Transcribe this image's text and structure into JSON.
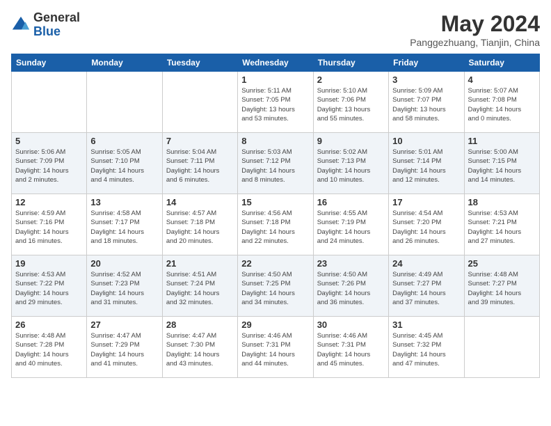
{
  "header": {
    "logo_general": "General",
    "logo_blue": "Blue",
    "month_year": "May 2024",
    "location": "Panggezhuang, Tianjin, China"
  },
  "days_of_week": [
    "Sunday",
    "Monday",
    "Tuesday",
    "Wednesday",
    "Thursday",
    "Friday",
    "Saturday"
  ],
  "weeks": [
    [
      {
        "day": "",
        "info": ""
      },
      {
        "day": "",
        "info": ""
      },
      {
        "day": "",
        "info": ""
      },
      {
        "day": "1",
        "info": "Sunrise: 5:11 AM\nSunset: 7:05 PM\nDaylight: 13 hours\nand 53 minutes."
      },
      {
        "day": "2",
        "info": "Sunrise: 5:10 AM\nSunset: 7:06 PM\nDaylight: 13 hours\nand 55 minutes."
      },
      {
        "day": "3",
        "info": "Sunrise: 5:09 AM\nSunset: 7:07 PM\nDaylight: 13 hours\nand 58 minutes."
      },
      {
        "day": "4",
        "info": "Sunrise: 5:07 AM\nSunset: 7:08 PM\nDaylight: 14 hours\nand 0 minutes."
      }
    ],
    [
      {
        "day": "5",
        "info": "Sunrise: 5:06 AM\nSunset: 7:09 PM\nDaylight: 14 hours\nand 2 minutes."
      },
      {
        "day": "6",
        "info": "Sunrise: 5:05 AM\nSunset: 7:10 PM\nDaylight: 14 hours\nand 4 minutes."
      },
      {
        "day": "7",
        "info": "Sunrise: 5:04 AM\nSunset: 7:11 PM\nDaylight: 14 hours\nand 6 minutes."
      },
      {
        "day": "8",
        "info": "Sunrise: 5:03 AM\nSunset: 7:12 PM\nDaylight: 14 hours\nand 8 minutes."
      },
      {
        "day": "9",
        "info": "Sunrise: 5:02 AM\nSunset: 7:13 PM\nDaylight: 14 hours\nand 10 minutes."
      },
      {
        "day": "10",
        "info": "Sunrise: 5:01 AM\nSunset: 7:14 PM\nDaylight: 14 hours\nand 12 minutes."
      },
      {
        "day": "11",
        "info": "Sunrise: 5:00 AM\nSunset: 7:15 PM\nDaylight: 14 hours\nand 14 minutes."
      }
    ],
    [
      {
        "day": "12",
        "info": "Sunrise: 4:59 AM\nSunset: 7:16 PM\nDaylight: 14 hours\nand 16 minutes."
      },
      {
        "day": "13",
        "info": "Sunrise: 4:58 AM\nSunset: 7:17 PM\nDaylight: 14 hours\nand 18 minutes."
      },
      {
        "day": "14",
        "info": "Sunrise: 4:57 AM\nSunset: 7:18 PM\nDaylight: 14 hours\nand 20 minutes."
      },
      {
        "day": "15",
        "info": "Sunrise: 4:56 AM\nSunset: 7:18 PM\nDaylight: 14 hours\nand 22 minutes."
      },
      {
        "day": "16",
        "info": "Sunrise: 4:55 AM\nSunset: 7:19 PM\nDaylight: 14 hours\nand 24 minutes."
      },
      {
        "day": "17",
        "info": "Sunrise: 4:54 AM\nSunset: 7:20 PM\nDaylight: 14 hours\nand 26 minutes."
      },
      {
        "day": "18",
        "info": "Sunrise: 4:53 AM\nSunset: 7:21 PM\nDaylight: 14 hours\nand 27 minutes."
      }
    ],
    [
      {
        "day": "19",
        "info": "Sunrise: 4:53 AM\nSunset: 7:22 PM\nDaylight: 14 hours\nand 29 minutes."
      },
      {
        "day": "20",
        "info": "Sunrise: 4:52 AM\nSunset: 7:23 PM\nDaylight: 14 hours\nand 31 minutes."
      },
      {
        "day": "21",
        "info": "Sunrise: 4:51 AM\nSunset: 7:24 PM\nDaylight: 14 hours\nand 32 minutes."
      },
      {
        "day": "22",
        "info": "Sunrise: 4:50 AM\nSunset: 7:25 PM\nDaylight: 14 hours\nand 34 minutes."
      },
      {
        "day": "23",
        "info": "Sunrise: 4:50 AM\nSunset: 7:26 PM\nDaylight: 14 hours\nand 36 minutes."
      },
      {
        "day": "24",
        "info": "Sunrise: 4:49 AM\nSunset: 7:27 PM\nDaylight: 14 hours\nand 37 minutes."
      },
      {
        "day": "25",
        "info": "Sunrise: 4:48 AM\nSunset: 7:27 PM\nDaylight: 14 hours\nand 39 minutes."
      }
    ],
    [
      {
        "day": "26",
        "info": "Sunrise: 4:48 AM\nSunset: 7:28 PM\nDaylight: 14 hours\nand 40 minutes."
      },
      {
        "day": "27",
        "info": "Sunrise: 4:47 AM\nSunset: 7:29 PM\nDaylight: 14 hours\nand 41 minutes."
      },
      {
        "day": "28",
        "info": "Sunrise: 4:47 AM\nSunset: 7:30 PM\nDaylight: 14 hours\nand 43 minutes."
      },
      {
        "day": "29",
        "info": "Sunrise: 4:46 AM\nSunset: 7:31 PM\nDaylight: 14 hours\nand 44 minutes."
      },
      {
        "day": "30",
        "info": "Sunrise: 4:46 AM\nSunset: 7:31 PM\nDaylight: 14 hours\nand 45 minutes."
      },
      {
        "day": "31",
        "info": "Sunrise: 4:45 AM\nSunset: 7:32 PM\nDaylight: 14 hours\nand 47 minutes."
      },
      {
        "day": "",
        "info": ""
      }
    ]
  ]
}
